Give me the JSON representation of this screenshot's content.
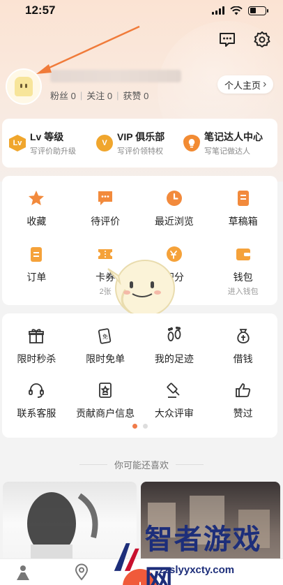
{
  "status_bar": {
    "time": "12:57"
  },
  "header": {
    "message_icon": "message-icon",
    "settings_icon": "gear-icon"
  },
  "profile": {
    "stats": [
      {
        "label": "粉丝",
        "value": "0"
      },
      {
        "label": "关注",
        "value": "0"
      },
      {
        "label": "获赞",
        "value": "0"
      }
    ],
    "homepage_button": "个人主页",
    "homepage_chevron": "›"
  },
  "levels": [
    {
      "badge": "Lv",
      "title": "Lv 等级",
      "subtitle": "写评价助升级"
    },
    {
      "badge": "V",
      "title": "VIP 俱乐部",
      "subtitle": "写评价领特权"
    },
    {
      "badge": "",
      "title": "笔记达人中心",
      "subtitle": "写笔记做达人"
    }
  ],
  "grid_main": {
    "row1": [
      {
        "label": "收藏",
        "icon": "star-icon"
      },
      {
        "label": "待评价",
        "icon": "comment-icon"
      },
      {
        "label": "最近浏览",
        "icon": "clock-icon"
      },
      {
        "label": "草稿箱",
        "icon": "draft-icon"
      }
    ],
    "row2": [
      {
        "label": "订单",
        "icon": "order-icon",
        "sub": ""
      },
      {
        "label": "卡券",
        "icon": "ticket-icon",
        "sub": "2张"
      },
      {
        "label": "积分",
        "icon": "points-icon",
        "sub": ""
      },
      {
        "label": "钱包",
        "icon": "wallet-icon",
        "sub": "进入钱包"
      }
    ]
  },
  "grid_tools": {
    "row1": [
      {
        "label": "限时秒杀",
        "icon": "gift-icon"
      },
      {
        "label": "限时免单",
        "icon": "free-coupon-icon"
      },
      {
        "label": "我的足迹",
        "icon": "footprint-icon"
      },
      {
        "label": "借钱",
        "icon": "money-bag-icon"
      }
    ],
    "row2": [
      {
        "label": "联系客服",
        "icon": "headset-icon"
      },
      {
        "label": "贡献商户信息",
        "icon": "shop-info-icon"
      },
      {
        "label": "大众评审",
        "icon": "gavel-icon"
      },
      {
        "label": "赞过",
        "icon": "thumbs-up-icon"
      }
    ],
    "page_dots": {
      "count": 2,
      "active": 1
    }
  },
  "recommend": {
    "title": "你可能还喜欢"
  },
  "fab": {
    "label": "+"
  },
  "watermark": {
    "text": "智者游戏网",
    "url": "zzslyyxcty.com"
  },
  "colors": {
    "accent": "#f07b4a",
    "gold": "#f0a62d",
    "fab": "#f05a3a"
  }
}
